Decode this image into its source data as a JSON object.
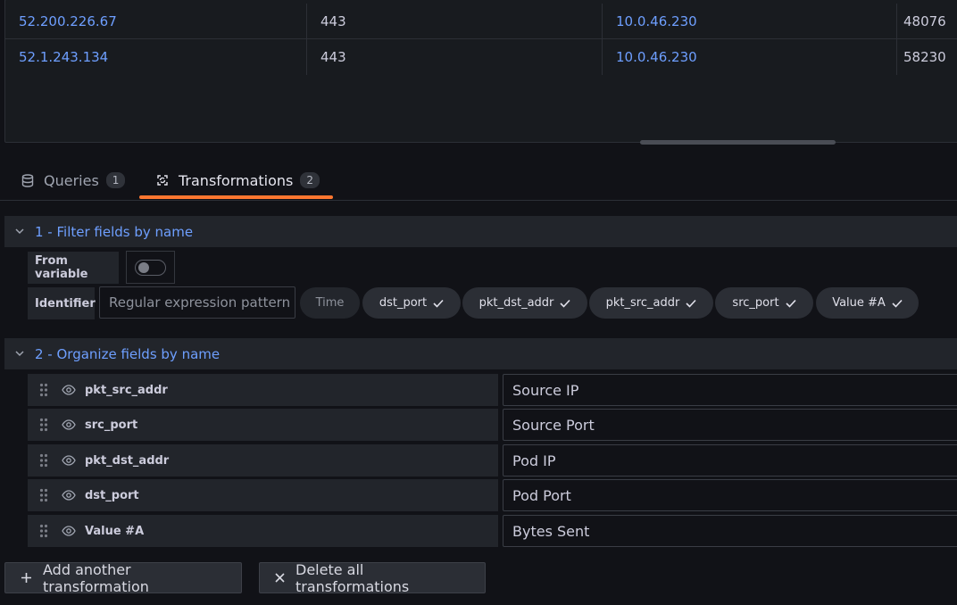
{
  "table": {
    "rows": [
      [
        "52.200.226.67",
        "443",
        "10.0.46.230",
        "48076"
      ],
      [
        "52.1.243.134",
        "443",
        "10.0.46.230",
        "58230"
      ]
    ]
  },
  "tabs": {
    "queries": {
      "label": "Queries",
      "count": "1"
    },
    "transformations": {
      "label": "Transformations",
      "count": "2"
    }
  },
  "transform1": {
    "title": "1 - Filter fields by name",
    "from_variable_label": "From variable",
    "identifier_label": "Identifier",
    "regex_placeholder": "Regular expression pattern",
    "fields": [
      {
        "name": "Time",
        "selected": false
      },
      {
        "name": "dst_port",
        "selected": true
      },
      {
        "name": "pkt_dst_addr",
        "selected": true
      },
      {
        "name": "pkt_src_addr",
        "selected": true
      },
      {
        "name": "src_port",
        "selected": true
      },
      {
        "name": "Value #A",
        "selected": true
      }
    ]
  },
  "transform2": {
    "title": "2 - Organize fields by name",
    "rows": [
      {
        "field": "pkt_src_addr",
        "rename": "Source IP"
      },
      {
        "field": "src_port",
        "rename": "Source Port"
      },
      {
        "field": "pkt_dst_addr",
        "rename": "Pod IP"
      },
      {
        "field": "dst_port",
        "rename": "Pod Port"
      },
      {
        "field": "Value #A",
        "rename": "Bytes Sent"
      }
    ]
  },
  "buttons": {
    "add": "Add another transformation",
    "delete": "Delete all transformations"
  },
  "colors": {
    "link": "#6e9fff",
    "accent": "#ff7730",
    "background": "#111217"
  }
}
